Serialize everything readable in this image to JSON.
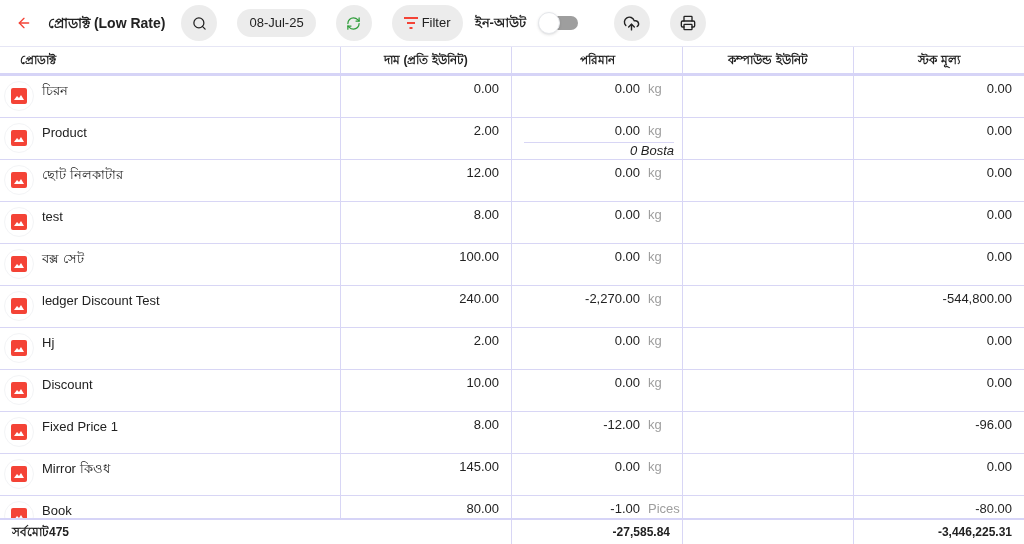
{
  "toolbar": {
    "title": "প্রোডাক্ট (Low Rate)",
    "date": "08-Jul-25",
    "filter": "Filter",
    "toggle": {
      "label": "ইন-আউট",
      "on": false
    }
  },
  "table": {
    "columns": [
      "প্রোডাক্ট",
      "দাম (প্রতি ইউনিট)",
      "পরিমান",
      "কম্পাউন্ড ইউনিট",
      "স্টক মূল্য"
    ],
    "rows": [
      {
        "name": "চিরন",
        "price": "0.00",
        "qty": "0.00",
        "unit": "kg",
        "value": "0.00"
      },
      {
        "name": "Product",
        "price": "2.00",
        "qty": "0.00",
        "unit": "kg",
        "sub": "0 Bosta",
        "value": "0.00"
      },
      {
        "name": "ছোট নিলকাটার",
        "price": "12.00",
        "qty": "0.00",
        "unit": "kg",
        "value": "0.00"
      },
      {
        "name": "test",
        "price": "8.00",
        "qty": "0.00",
        "unit": "kg",
        "value": "0.00"
      },
      {
        "name": "বক্স সেট",
        "price": "100.00",
        "qty": "0.00",
        "unit": "kg",
        "value": "0.00"
      },
      {
        "name": "ledger Discount Test",
        "price": "240.00",
        "qty": "-2,270.00",
        "unit": "kg",
        "value": "-544,800.00"
      },
      {
        "name": "Hj",
        "price": "2.00",
        "qty": "0.00",
        "unit": "kg",
        "value": "0.00"
      },
      {
        "name": "Discount",
        "price": "10.00",
        "qty": "0.00",
        "unit": "kg",
        "value": "0.00"
      },
      {
        "name": "Fixed Price 1",
        "price": "8.00",
        "qty": "-12.00",
        "unit": "kg",
        "value": "-96.00"
      },
      {
        "name": "Mirror কিওধ",
        "price": "145.00",
        "qty": "0.00",
        "unit": "kg",
        "value": "0.00"
      },
      {
        "name": "Book",
        "price": "80.00",
        "qty": "-1.00",
        "unit": "Pices",
        "value": "-80.00"
      }
    ],
    "footer": {
      "label": "সর্বমোট475",
      "qty": "-27,585.84",
      "value": "-3,446,225.31"
    }
  }
}
